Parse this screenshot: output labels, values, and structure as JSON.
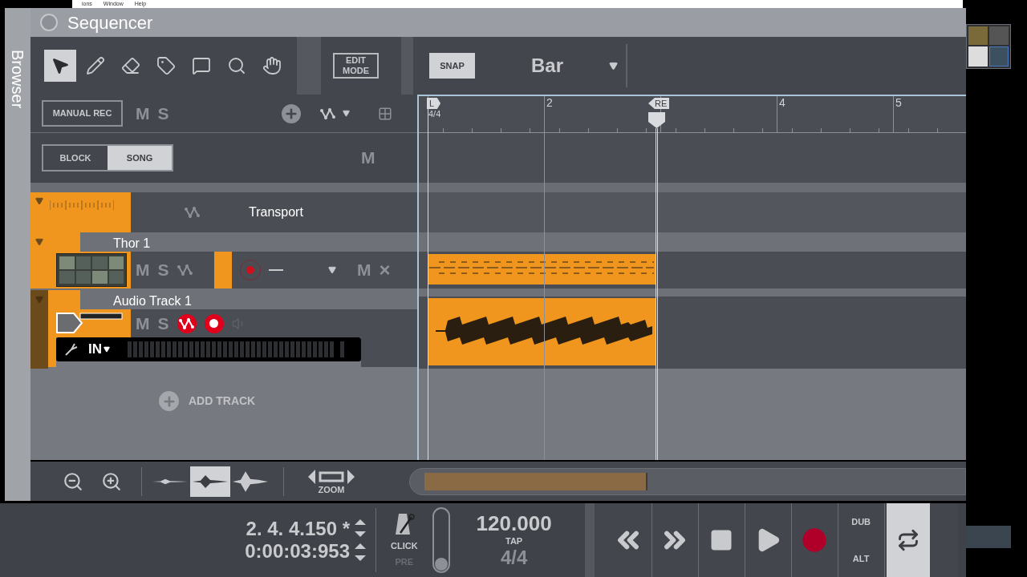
{
  "menu": [
    "ions",
    "Window",
    "Help"
  ],
  "sidebar_tab": "Browser",
  "window": {
    "title": "Sequencer"
  },
  "tools": [
    {
      "kind": "pointer",
      "selected": true
    },
    {
      "kind": "pencil",
      "selected": false
    },
    {
      "kind": "eraser",
      "selected": false
    },
    {
      "kind": "razor",
      "selected": false
    },
    {
      "kind": "mute",
      "selected": false
    },
    {
      "kind": "magnify",
      "selected": false
    },
    {
      "kind": "hand",
      "selected": false
    }
  ],
  "edit_mode": [
    "EDIT",
    "MODE"
  ],
  "snap": {
    "label": "SNAP",
    "value": "Bar"
  },
  "track_header": {
    "manual_rec": "MANUAL REC",
    "mute": "M",
    "solo": "S"
  },
  "view_mode": [
    {
      "label": "BLOCK",
      "selected": false
    },
    {
      "label": "SONG",
      "selected": true
    }
  ],
  "mute_all": "M",
  "tracks": [
    {
      "kind": "transport",
      "name": "Transport"
    },
    {
      "kind": "instrument",
      "name": "Thor 1",
      "mute": "M",
      "solo": "S",
      "record_armed": false,
      "lane_mute": "M",
      "lane_delete": "×"
    },
    {
      "kind": "audio",
      "name": "Audio Track 1",
      "mute": "M",
      "solo": "S",
      "automation_on": true,
      "record_armed": true,
      "input": "IN"
    }
  ],
  "add_track": "ADD TRACK",
  "ruler": {
    "left_locator": "L",
    "right_locator": "RE",
    "time_signature": "4/4",
    "bars": [
      "2",
      "4",
      "5"
    ]
  },
  "zoom_bar": {
    "waveform_sizes": [
      {
        "selected": false
      },
      {
        "selected": true
      },
      {
        "selected": false
      }
    ],
    "zoom_label": "ZOOM"
  },
  "transport": {
    "position": "2. 4. 4.150 *",
    "time": "0:00:03:953",
    "click": "CLICK",
    "pre": "PRE",
    "click_level": {
      "level": 0
    },
    "tempo": "120.000",
    "tap": "TAP",
    "signature": "4/4",
    "dub": "DUB",
    "alt": "ALT",
    "loop": {
      "on": true
    }
  }
}
